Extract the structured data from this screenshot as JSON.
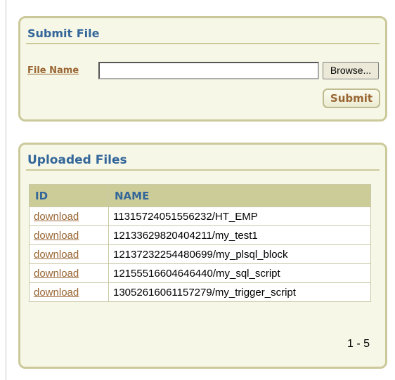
{
  "submit_region": {
    "title": "Submit File",
    "file_label": "File Name",
    "file_value": "",
    "browse_label": "Browse...",
    "submit_label": "Submit"
  },
  "files_region": {
    "title": "Uploaded Files",
    "columns": [
      "ID",
      "NAME"
    ],
    "rows": [
      {
        "id": "download",
        "name": "11315724051556232/HT_EMP"
      },
      {
        "id": "download",
        "name": "12133629820404211/my_test1"
      },
      {
        "id": "download",
        "name": "12137232254480699/my_plsql_block"
      },
      {
        "id": "download",
        "name": "12155516604646440/my_sql_script"
      },
      {
        "id": "download",
        "name": "13052616061157279/my_trigger_script"
      }
    ],
    "pagination": "1 - 5"
  },
  "colors": {
    "region_bg": "#f7f7e7",
    "region_border": "#cbc99a",
    "title": "#336699",
    "link": "#996633",
    "header_bg": "#cccc99"
  }
}
